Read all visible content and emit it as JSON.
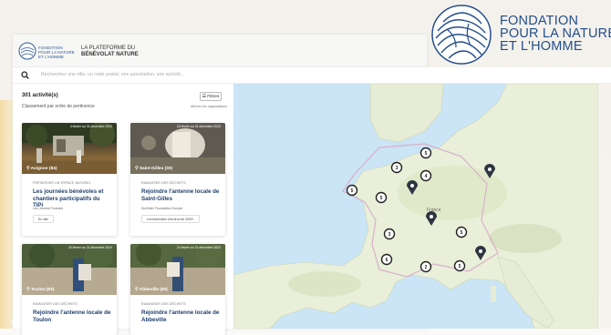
{
  "brand": {
    "lines": [
      "FONDATION",
      "POUR LA NATURE",
      "ET L'HOMME"
    ],
    "color": "#244e8c"
  },
  "header": {
    "mini_logo_lines": [
      "FONDATION",
      "POUR LA NATURE",
      "ET L'HOMME"
    ],
    "platform_line1": "LA PLATEFORME DU",
    "platform_line2": "BÉNÉVOLAT NATURE"
  },
  "search": {
    "icon": "search-icon",
    "placeholder": "Recherchez une ville, un code postal, une association, une activité..."
  },
  "results": {
    "count": "301 activité(s)",
    "sort": "Classement par ordre de pertinence",
    "filters_label": "Filtres",
    "filters_sub": "Afficher les organisations"
  },
  "cards": [
    {
      "date": "4 février au 31 décembre 2023",
      "place": "Avignon (84)",
      "category": "PRÉSERVER UN ESPACE NATUREL",
      "title": "Les journées bénévoles et chantiers participatifs du TiPi",
      "org": "Les Jeunes Pousses",
      "tag": "En ville"
    },
    {
      "date": "24 février au 31 décembre 2023",
      "place": "Saint-Gilles (30)",
      "category": "RAMASSER DES DÉCHETS",
      "title": "Rejoindre l'antenne locale de Saint-Gilles",
      "org": "Surfrider Foundation Europe",
      "tag": "Les bénévoles d'environ de 2000+"
    },
    {
      "date": "24 février au 31 décembre 2023",
      "place": "Toulon (83)",
      "category": "RAMASSER DES DÉCHETS",
      "title": "Rejoindre l'antenne locale de Toulon"
    },
    {
      "date": "24 février au 31 décembre 2023",
      "place": "Abbeville (80)",
      "category": "RAMASSER DES DÉCHETS",
      "title": "Rejoindre l'antenne locale de Abbeville"
    }
  ],
  "map": {
    "clusters": [
      "5",
      "3",
      "4",
      "5",
      "5",
      "3",
      "5",
      "6",
      "2",
      "5"
    ],
    "pin_icon": "map-pin-icon",
    "country_label": "France"
  },
  "colors": {
    "accent": "#1f3f6e",
    "sea": "#cbe4f6",
    "land": "#e9efd9"
  }
}
